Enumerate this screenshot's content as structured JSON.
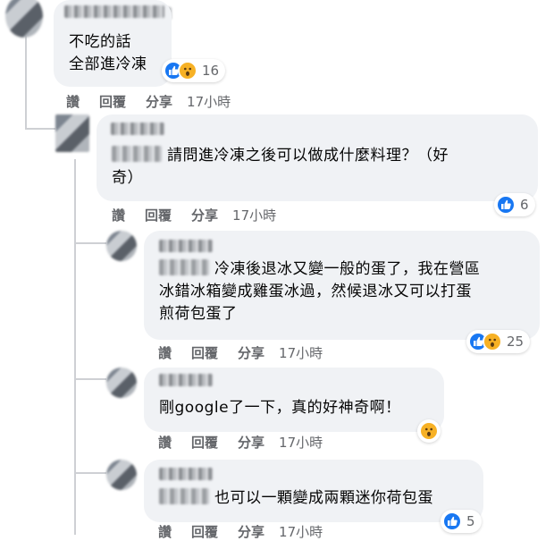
{
  "c1": {
    "lines": [
      "不吃的話",
      "全部進冷凍"
    ],
    "count": "16"
  },
  "c2": {
    "lines": [
      "請問進冷凍之後可以做成什麼料理？（好",
      "奇）"
    ],
    "count": "6"
  },
  "c3": {
    "lines": [
      "冷凍後退冰又變一般的蛋了，我在營區",
      "冰錯冰箱變成雞蛋冰過，然候退冰又可以打蛋",
      "煎荷包蛋了"
    ],
    "count": "25"
  },
  "c4": {
    "lines": [
      "剛google了一下，真的好神奇啊！"
    ]
  },
  "c5": {
    "lines": [
      "也可以一顆變成兩顆迷你荷包蛋"
    ],
    "count": "5"
  },
  "actions": {
    "like": "讚",
    "reply": "回覆",
    "share": "分享",
    "time": "17小時"
  },
  "icons": {
    "like": "like-reaction-icon",
    "wow": "wow-reaction-icon"
  },
  "colors": {
    "bubble": "#f0f2f5",
    "like": "#1877f2",
    "wow": "#f7b125",
    "meta": "#65676b"
  }
}
